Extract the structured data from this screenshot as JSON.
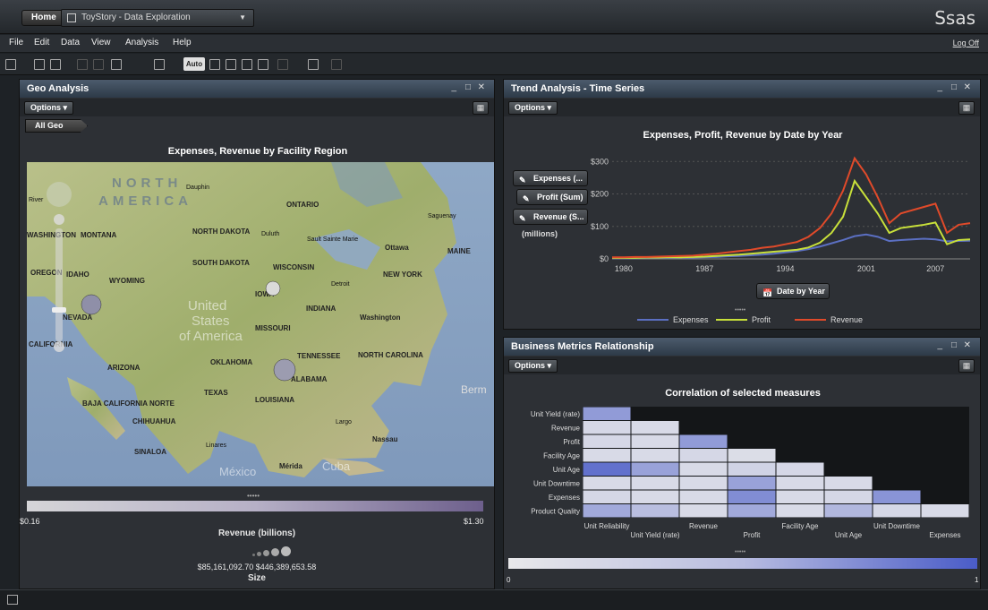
{
  "topbar": {
    "home_label": "Home",
    "report_tab": "ToyStory - Data Exploration",
    "logo_text": "Ssas"
  },
  "menu": {
    "items": [
      "File",
      "Edit",
      "Data",
      "View",
      "Analysis",
      "Help"
    ],
    "logoff": "Log Off"
  },
  "toolbar": {
    "auto_label": "Auto"
  },
  "geo_panel": {
    "title": "Geo Analysis",
    "options_label": "Options",
    "breadcrumb": "All Geo",
    "chart_title": "Expenses, Revenue by Facility Region",
    "map_labels": {
      "north_america": "NORTH",
      "america": "AMERICA",
      "united": "United",
      "states": "States",
      "of_america": "of America",
      "mexico": "México",
      "cuba": "Cuba",
      "berm": "Berm",
      "river": "River",
      "places": [
        "WASHINGTON",
        "MONTANA",
        "NORTH DAKOTA",
        "SOUTH DAKOTA",
        "OREGON",
        "IDAHO",
        "WYOMING",
        "NEVADA",
        "CALIFORNIA",
        "ARIZONA",
        "TEXAS",
        "OKLAHOMA",
        "IOWA",
        "MISSOURI",
        "INDIANA",
        "TENNESSEE",
        "NORTH CAROLINA",
        "ALABAMA",
        "LOUISIANA",
        "MAINE",
        "NEW YORK",
        "WISCONSIN",
        "ONTARIO",
        "BAJA CALIFORNIA NORTE",
        "CHIHUAHUA",
        "SINALOA",
        "Dauphin",
        "Duluth",
        "Sault Sainte Marie",
        "Ottawa",
        "Saguenay",
        "Detroit",
        "Washington",
        "Largo",
        "Nassau",
        "Linares",
        "Mérida"
      ]
    },
    "color_legend": {
      "min": "$0.16",
      "max": "$1.30",
      "title": "Revenue  (billions)"
    },
    "size_legend": {
      "min": "$85,161,092.70",
      "max": "$446,389,653.58",
      "title": "Size"
    }
  },
  "trend_panel": {
    "title": "Trend Analysis - Time Series",
    "options_label": "Options",
    "measure_pills": [
      "Expenses (...",
      "Profit (Sum)",
      "Revenue (S..."
    ],
    "units_note": "(millions)",
    "x_role_pill": "Date by Year",
    "legend": [
      "Expenses",
      "Profit",
      "Revenue"
    ]
  },
  "metrics_panel": {
    "title": "Business Metrics Relationship",
    "options_label": "Options",
    "chart_title": "Correlation of selected measures",
    "scale": {
      "min": "0",
      "max": "1"
    }
  },
  "chart_data": [
    {
      "type": "line",
      "title": "Expenses, Profit, Revenue by Date by Year",
      "xlabel": "Date by Year",
      "ylabel": "(millions)",
      "x": [
        1979,
        1980,
        1981,
        1982,
        1983,
        1984,
        1985,
        1986,
        1987,
        1988,
        1989,
        1990,
        1991,
        1992,
        1993,
        1994,
        1995,
        1996,
        1997,
        1998,
        1999,
        2000,
        2001,
        2002,
        2003,
        2004,
        2005,
        2006,
        2007,
        2008,
        2009,
        2010
      ],
      "x_ticks": [
        "1980",
        "1987",
        "1994",
        "2001",
        "2007"
      ],
      "y_ticks": [
        "$0",
        "$100",
        "$200",
        "$300"
      ],
      "ylim": [
        0,
        320
      ],
      "xlim": [
        1979,
        2010
      ],
      "series": [
        {
          "name": "Expenses",
          "color": "#5b6fc2",
          "values": [
            2,
            2,
            2,
            3,
            3,
            3,
            4,
            4,
            5,
            6,
            8,
            9,
            11,
            13,
            16,
            20,
            24,
            30,
            38,
            48,
            58,
            70,
            75,
            68,
            55,
            58,
            60,
            62,
            60,
            54,
            55,
            56
          ]
        },
        {
          "name": "Profit",
          "color": "#c8e03a",
          "values": [
            3,
            3,
            3,
            4,
            4,
            5,
            5,
            6,
            7,
            9,
            11,
            13,
            16,
            19,
            22,
            25,
            28,
            35,
            50,
            80,
            130,
            240,
            190,
            140,
            80,
            95,
            100,
            105,
            112,
            45,
            58,
            60
          ]
        },
        {
          "name": "Revenue",
          "color": "#e04a2a",
          "values": [
            5,
            5,
            6,
            6,
            7,
            8,
            9,
            10,
            13,
            16,
            20,
            24,
            28,
            34,
            38,
            45,
            52,
            68,
            95,
            140,
            210,
            310,
            260,
            190,
            110,
            140,
            150,
            160,
            170,
            80,
            105,
            110
          ]
        }
      ],
      "grid": true,
      "legend_position": "bottom"
    },
    {
      "type": "heatmap",
      "title": "Correlation of selected measures",
      "rows": [
        "Unit Yield (rate)",
        "Revenue",
        "Profit",
        "Facility Age",
        "Unit Age",
        "Unit Downtime",
        "Expenses",
        "Product Quality"
      ],
      "columns": [
        "Unit Reliability",
        "Unit Yield (rate)",
        "Revenue",
        "Profit",
        "Facility Age",
        "Unit Age",
        "Unit Downtime",
        "Expenses"
      ],
      "values": [
        [
          0.55,
          null,
          null,
          null,
          null,
          null,
          null,
          null
        ],
        [
          0.12,
          0.1,
          null,
          null,
          null,
          null,
          null,
          null
        ],
        [
          0.12,
          0.1,
          0.55,
          null,
          null,
          null,
          null,
          null
        ],
        [
          0.1,
          0.1,
          0.12,
          0.08,
          null,
          null,
          null,
          null
        ],
        [
          0.85,
          0.5,
          0.1,
          0.15,
          0.12,
          null,
          null,
          null
        ],
        [
          0.1,
          0.1,
          0.1,
          0.5,
          0.1,
          0.1,
          null,
          null
        ],
        [
          0.12,
          0.1,
          0.1,
          0.65,
          0.1,
          0.12,
          0.6,
          null
        ],
        [
          0.45,
          0.3,
          0.1,
          0.45,
          0.1,
          0.35,
          0.12,
          0.1
        ]
      ],
      "color_range": [
        0,
        1
      ]
    }
  ],
  "colors": {
    "accent": "#5b6fc2",
    "panel_header": "#3c4a5a"
  }
}
